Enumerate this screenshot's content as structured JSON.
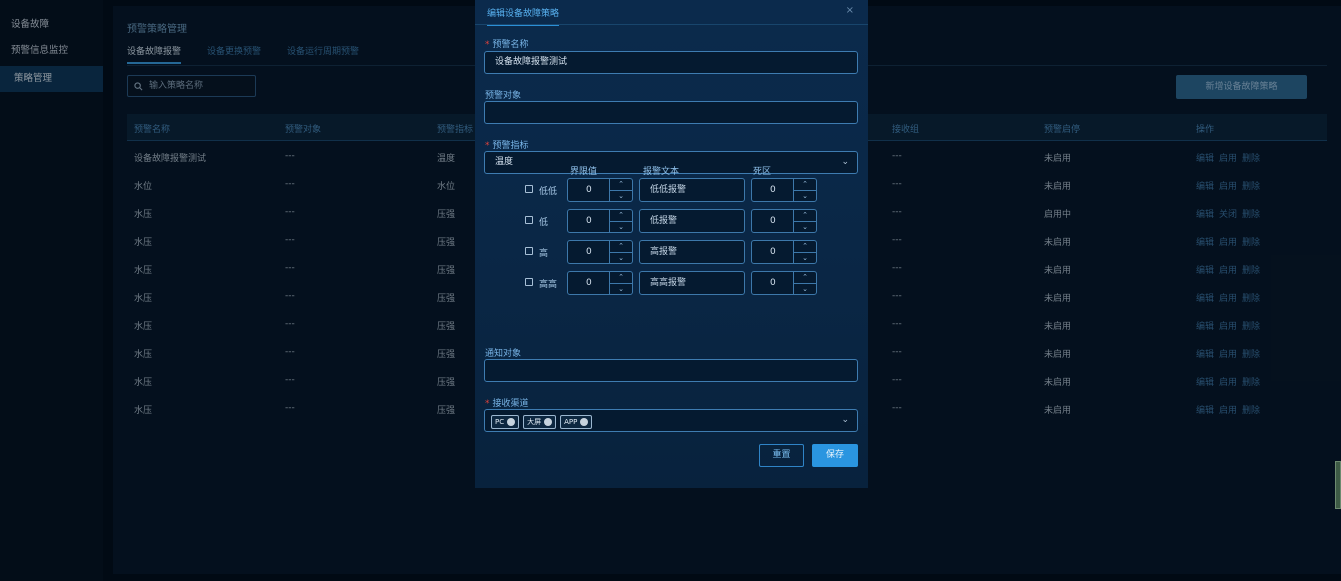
{
  "sidebar": {
    "items": [
      {
        "label": "设备故障"
      },
      {
        "label": "预警信息监控"
      },
      {
        "label": "策略管理"
      }
    ]
  },
  "main": {
    "title": "预警策略管理",
    "tabs": [
      {
        "label": "设备故障报警"
      },
      {
        "label": "设备更换预警"
      },
      {
        "label": "设备运行周期预警"
      }
    ],
    "search_placeholder": "输入策略名称",
    "add_button": "新增设备故障策略",
    "columns": [
      "预警名称",
      "预警对象",
      "预警指标",
      "接收组",
      "预警启停",
      "操作"
    ],
    "rows": [
      {
        "name": "设备故障报警测试",
        "target": "---",
        "indicator": "温度",
        "group": "---",
        "status": "未启用",
        "toggle": "启用"
      },
      {
        "name": "水位",
        "target": "---",
        "indicator": "水位",
        "group": "---",
        "status": "未启用",
        "toggle": "启用"
      },
      {
        "name": "水压",
        "target": "---",
        "indicator": "压强",
        "group": "---",
        "status": "启用中",
        "toggle": "关闭"
      },
      {
        "name": "水压",
        "target": "---",
        "indicator": "压强",
        "group": "---",
        "status": "未启用",
        "toggle": "启用"
      },
      {
        "name": "水压",
        "target": "---",
        "indicator": "压强",
        "group": "---",
        "status": "未启用",
        "toggle": "启用"
      },
      {
        "name": "水压",
        "target": "---",
        "indicator": "压强",
        "group": "---",
        "status": "未启用",
        "toggle": "启用"
      },
      {
        "name": "水压",
        "target": "---",
        "indicator": "压强",
        "group": "---",
        "status": "未启用",
        "toggle": "启用"
      },
      {
        "name": "水压",
        "target": "---",
        "indicator": "压强",
        "group": "---",
        "status": "未启用",
        "toggle": "启用"
      },
      {
        "name": "水压",
        "target": "---",
        "indicator": "压强",
        "group": "---",
        "status": "未启用",
        "toggle": "启用"
      },
      {
        "name": "水压",
        "target": "---",
        "indicator": "压强",
        "group": "---",
        "status": "未启用",
        "toggle": "启用"
      }
    ],
    "op_edit": "编辑",
    "op_delete": "删除"
  },
  "modal": {
    "title": "编辑设备故障策略",
    "close_icon": "×",
    "name_label": "预警名称",
    "name_value": "设备故障报警测试",
    "target_label": "预警对象",
    "target_value": "",
    "indicator_label": "预警指标",
    "indicator_value": "温度",
    "grid_headers": {
      "threshold": "界限值",
      "text": "报警文本",
      "deadband": "死区"
    },
    "levels": [
      {
        "name": "低低",
        "threshold": "0",
        "text": "低低报警",
        "deadband": "0"
      },
      {
        "name": "低",
        "threshold": "0",
        "text": "低报警",
        "deadband": "0"
      },
      {
        "name": "高",
        "threshold": "0",
        "text": "高报警",
        "deadband": "0"
      },
      {
        "name": "高高",
        "threshold": "0",
        "text": "高高报警",
        "deadband": "0"
      }
    ],
    "notify_label": "通知对象",
    "notify_value": "",
    "channel_label": "接收渠道",
    "channels": [
      "PC",
      "大屏",
      "APP"
    ],
    "reset_button": "重置",
    "save_button": "保存"
  },
  "colors": {
    "accent": "#2a95e0",
    "required": "#e0413a",
    "background": "#03101f"
  }
}
